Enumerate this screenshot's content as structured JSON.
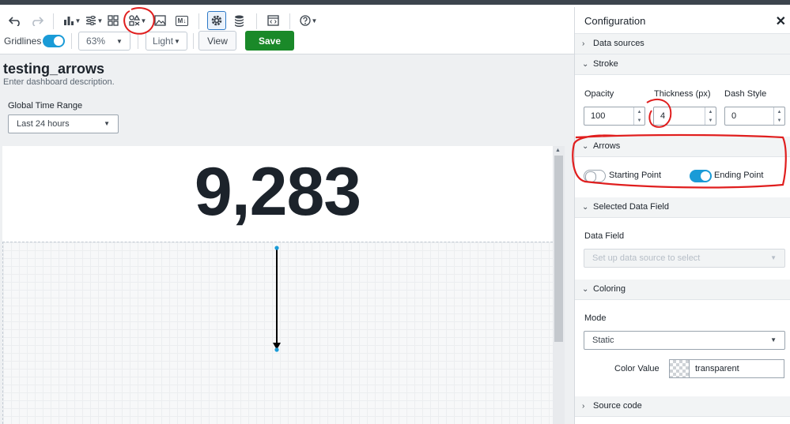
{
  "toolbar": {
    "gridlines_label": "Gridlines",
    "zoom_value": "63%",
    "theme_value": "Light",
    "view_label": "View",
    "save_label": "Save",
    "icons": [
      "undo-icon",
      "redo-icon",
      "bar-chart-icon",
      "sliders-icon",
      "grid-icon",
      "shapes-icon",
      "image-icon",
      "markdown-icon",
      "gear-icon",
      "database-icon",
      "code-icon",
      "help-icon"
    ],
    "markdown_text": "M↓"
  },
  "dashboard": {
    "title": "testing_arrows",
    "description": "Enter dashboard description.",
    "time_range_label": "Global Time Range",
    "time_range_value": "Last 24 hours",
    "single_value": "9,283"
  },
  "panel": {
    "title": "Configuration",
    "sections": {
      "data_sources": "Data sources",
      "stroke": "Stroke",
      "arrows": "Arrows",
      "selected_data_field": "Selected Data Field",
      "coloring": "Coloring",
      "source_code": "Source code"
    },
    "stroke": {
      "opacity_label": "Opacity",
      "opacity_value": "100",
      "thickness_label": "Thickness (px)",
      "thickness_value": "4",
      "dash_label": "Dash Style",
      "dash_value": "0"
    },
    "arrows": {
      "starting_label": "Starting Point",
      "starting_on": false,
      "ending_label": "Ending Point",
      "ending_on": true
    },
    "data_field": {
      "label": "Data Field",
      "placeholder": "Set up data source to select"
    },
    "coloring": {
      "mode_label": "Mode",
      "mode_value": "Static",
      "color_value_label": "Color Value",
      "color_value": "transparent"
    }
  },
  "colors": {
    "accent": "#1a9bd7",
    "save_green": "#1a8929",
    "annotation_red": "#e01e1e"
  }
}
